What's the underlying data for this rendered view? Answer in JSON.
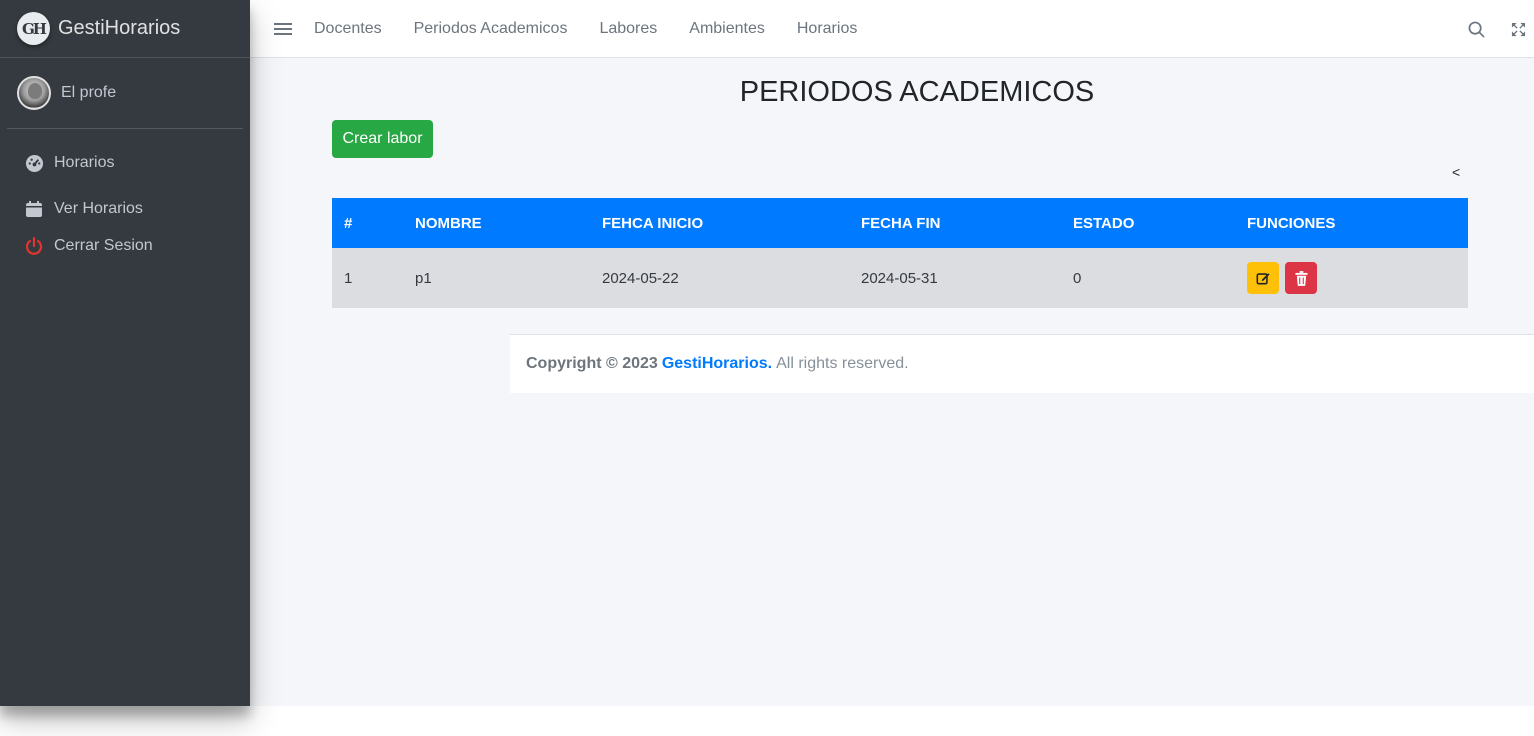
{
  "sidebar": {
    "brand_logo_text": "GH",
    "brand_name": "GestiHorarios",
    "user_name": "El profe",
    "items": [
      {
        "label": "Horarios",
        "icon": "tachometer-icon"
      },
      {
        "label": "Ver Horarios",
        "icon": "calendar-icon"
      },
      {
        "label": "Cerrar Sesion",
        "icon": "power-icon"
      }
    ]
  },
  "topbar": {
    "links": [
      "Docentes",
      "Periodos Academicos",
      "Labores",
      "Ambientes",
      "Horarios"
    ]
  },
  "main": {
    "title": "PERIODOS ACADEMICOS",
    "create_button": "Crear labor",
    "prev_arrow": "<",
    "table": {
      "headers": [
        "#",
        "NOMBRE",
        "FEHCA INICIO",
        "FECHA FIN",
        "ESTADO",
        "FUNCIONES"
      ],
      "rows": [
        [
          "1",
          "p1",
          "2024-05-22",
          "2024-05-31",
          "0"
        ]
      ]
    }
  },
  "footer": {
    "prefix": "Copyright © 2023",
    "brand": "GestiHorarios.",
    "suffix": "All rights reserved."
  },
  "colors": {
    "sidebar_bg": "#343a40",
    "primary": "#007bff",
    "success": "#28a745",
    "warning": "#ffc107",
    "danger": "#dc3545",
    "content_bg": "#f4f6f9"
  }
}
